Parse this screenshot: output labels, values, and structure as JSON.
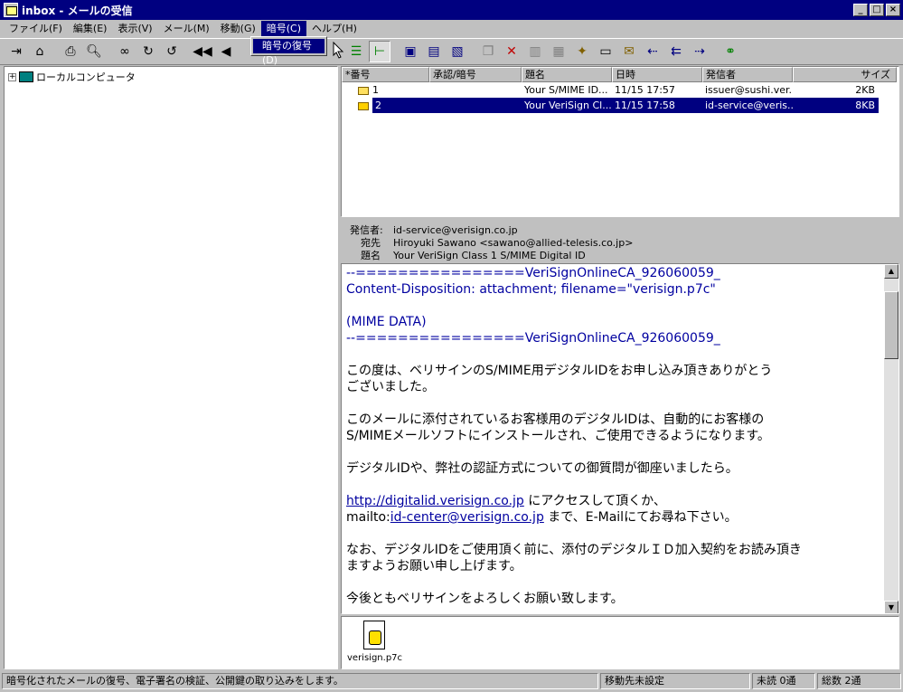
{
  "window": {
    "title": "inbox - メールの受信"
  },
  "menus": [
    "ファイル(F)",
    "編集(E)",
    "表示(V)",
    "メール(M)",
    "移動(G)",
    "暗号(C)",
    "ヘルプ(H)"
  ],
  "dropdown": {
    "item": "暗号の復号(D)"
  },
  "tree": {
    "root": "ローカルコンピュータ",
    "expander": "+"
  },
  "list": {
    "columns": [
      "*番号",
      "承認/暗号",
      "題名",
      "日時",
      "発信者",
      "サイズ"
    ],
    "rows": [
      {
        "num": "1",
        "subject": "Your S/MIME ID...",
        "date": "11/15 17:57",
        "from": "issuer@sushi.ver...",
        "size": "2KB"
      },
      {
        "num": "2",
        "subject": "Your VeriSign Cl...",
        "date": "11/15 17:58",
        "from": "id-service@veris...",
        "size": "8KB"
      }
    ]
  },
  "header": {
    "from_label": "発信者:",
    "from": "id-service@verisign.co.jp",
    "to_label": "宛先",
    "to": "Hiroyuki Sawano <sawano@allied-telesis.co.jp>",
    "subject_label": "題名",
    "subject": "Your VeriSign Class 1 S/MIME Digital ID"
  },
  "body": {
    "l1": "--================VeriSignOnlineCA_926060059_",
    "l2": "Content-Disposition: attachment; filename=\"verisign.p7c\"",
    "l3": "(MIME DATA)",
    "l4": "--================VeriSignOnlineCA_926060059_",
    "p1a": "この度は、ベリサインのS/MIME用デジタルIDをお申し込み頂きありがとう",
    "p1b": "ございました。",
    "p2a": "このメールに添付されているお客様用のデジタルIDは、自動的にお客様の",
    "p2b": "S/MIMEメールソフトにインストールされ、ご使用できるようになります。",
    "p3": "デジタルIDや、弊社の認証方式についての御質問が御座いましたら。",
    "link1": "http://digitalid.verisign.co.jp",
    "p4a_rest": " にアクセスして頂くか、",
    "mailto_prefix": "mailto:",
    "link2": "id-center@verisign.co.jp",
    "p4b_rest": " まで、E-Mailにてお尋ね下さい。",
    "p5a": "なお、デジタルIDをご使用頂く前に、添付のデジタルＩＤ加入契約をお読み頂き",
    "p5b": "ますようお願い申し上げます。",
    "p6": "今後ともベリサインをよろしくお願い致します。"
  },
  "attachment": {
    "name": "verisign.p7c"
  },
  "status": {
    "message": "暗号化されたメールの復号、電子署名の検証、公開鍵の取り込みをします。",
    "move": "移動先未設定",
    "unread": "未読 0通",
    "total": "総数 2通"
  },
  "colors": {
    "titlebar": "#000080",
    "selection": "#000080",
    "face": "#c0c0c0",
    "text_blue": "#0000a0"
  }
}
